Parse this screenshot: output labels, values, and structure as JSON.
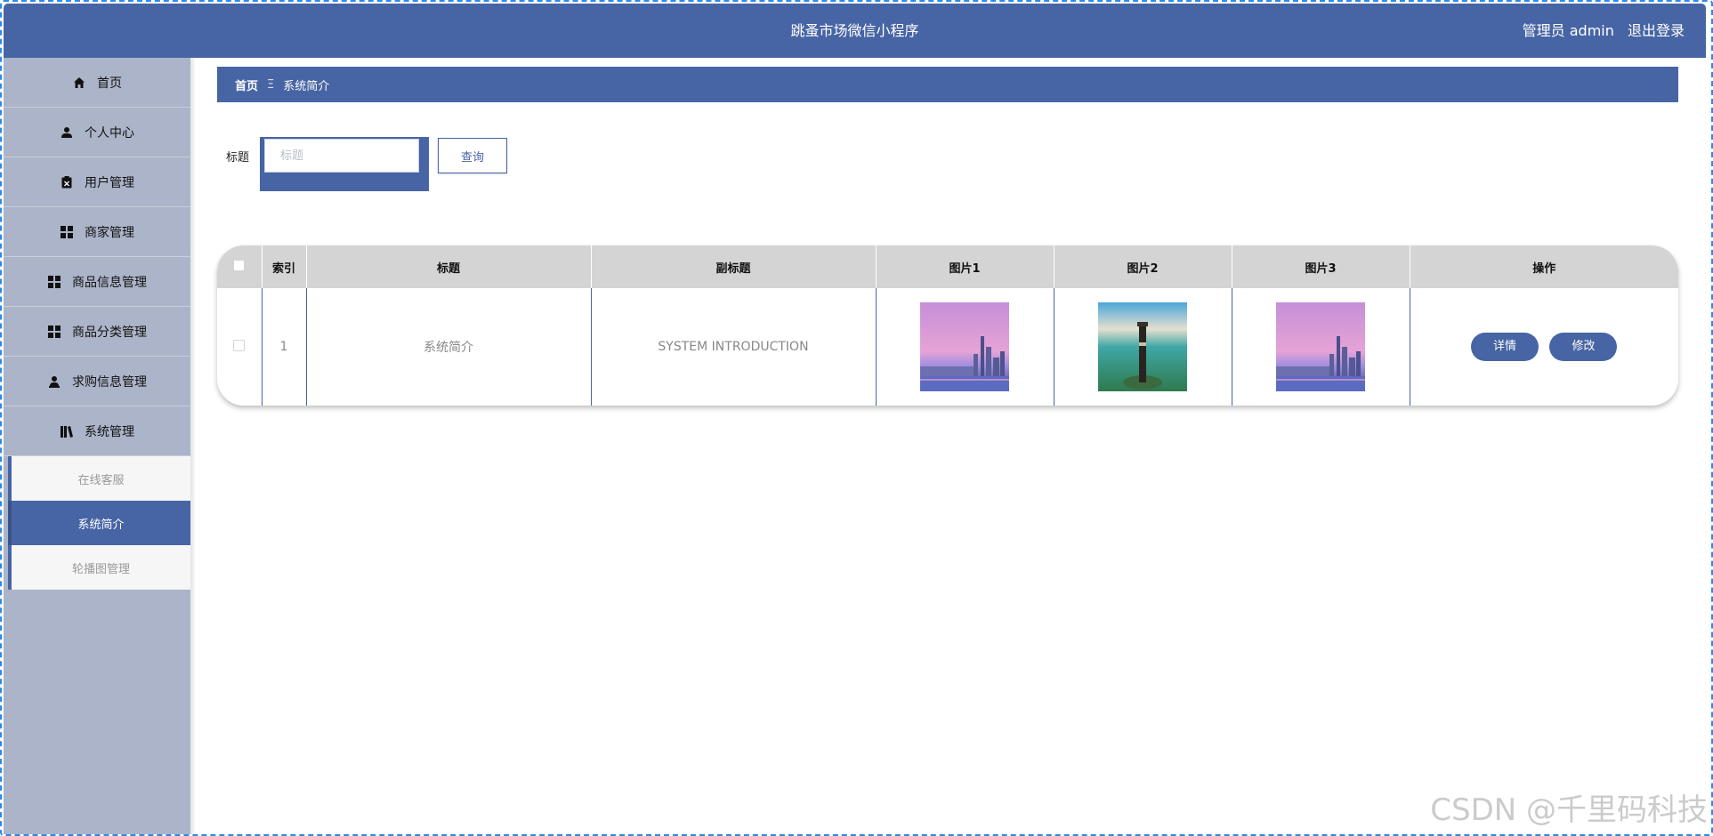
{
  "header": {
    "title": "跳蚤市场微信小程序",
    "user": "管理员 admin",
    "logout": "退出登录"
  },
  "sidebar": {
    "items": [
      {
        "label": "首页",
        "icon": "home-icon"
      },
      {
        "label": "个人中心",
        "icon": "person-icon"
      },
      {
        "label": "用户管理",
        "icon": "clipboard-icon"
      },
      {
        "label": "商家管理",
        "icon": "grid-icon"
      },
      {
        "label": "商品信息管理",
        "icon": "grid-icon"
      },
      {
        "label": "商品分类管理",
        "icon": "grid-icon"
      },
      {
        "label": "求购信息管理",
        "icon": "user-stamp-icon"
      },
      {
        "label": "系统管理",
        "icon": "library-icon"
      }
    ],
    "subitems": [
      {
        "label": "在线客服",
        "active": false
      },
      {
        "label": "系统简介",
        "active": true
      },
      {
        "label": "轮播图管理",
        "active": false
      }
    ]
  },
  "breadcrumb": {
    "home": "首页",
    "separator": "Ξ",
    "current": "系统简介"
  },
  "search": {
    "label": "标题",
    "placeholder": "标题",
    "value": "",
    "button": "查询"
  },
  "table": {
    "columns": [
      "",
      "索引",
      "标题",
      "副标题",
      "图片1",
      "图片2",
      "图片3",
      "操作"
    ],
    "rows": [
      {
        "index": "1",
        "title": "系统简介",
        "subtitle": "SYSTEM INTRODUCTION",
        "images": [
          "city-skyline-image",
          "lighthouse-image",
          "city-skyline-image"
        ]
      }
    ],
    "actions": {
      "detail": "详情",
      "edit": "修改"
    }
  },
  "watermark": "CSDN @千里码科技",
  "colors": {
    "primary": "#4765a4",
    "sidebar": "#abb4c8",
    "header_row": "#d4d4d4"
  }
}
